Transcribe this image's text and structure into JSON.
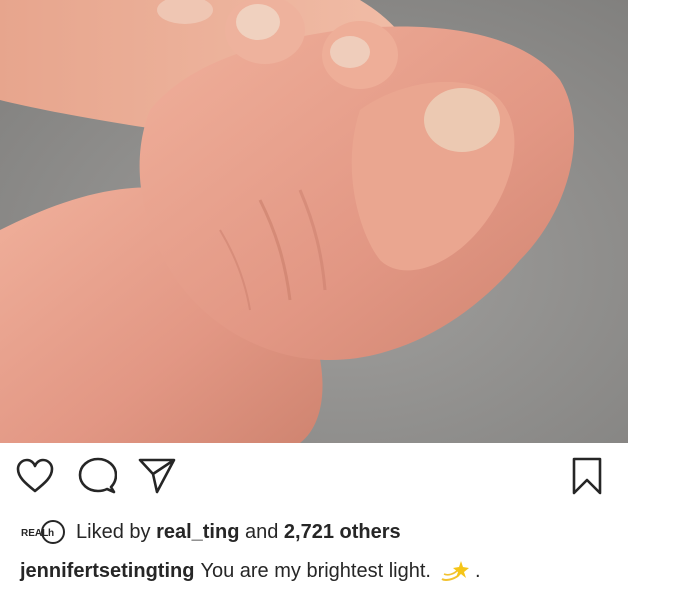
{
  "post": {
    "image": {
      "description_icon": "baby-hand-photo",
      "colors": {
        "background": "#8e8d8b",
        "skin": "#e8a08c",
        "skin_shadow": "#c97e6b",
        "nail": "#e9c7b0"
      }
    },
    "actions": {
      "like_icon": "heart-outline-icon",
      "comment_icon": "comment-bubble-icon",
      "share_icon": "paper-plane-icon",
      "save_icon": "bookmark-icon"
    },
    "likes": {
      "avatar_label": "REAL",
      "prefix": "Liked by",
      "user": "real_ting",
      "connector": "and",
      "others": "2,721 others"
    },
    "caption": {
      "username": "jennifertsetingting",
      "text": "You are my brightest light.",
      "emoji_icon": "dizzy-star-icon",
      "trailing": "."
    }
  }
}
